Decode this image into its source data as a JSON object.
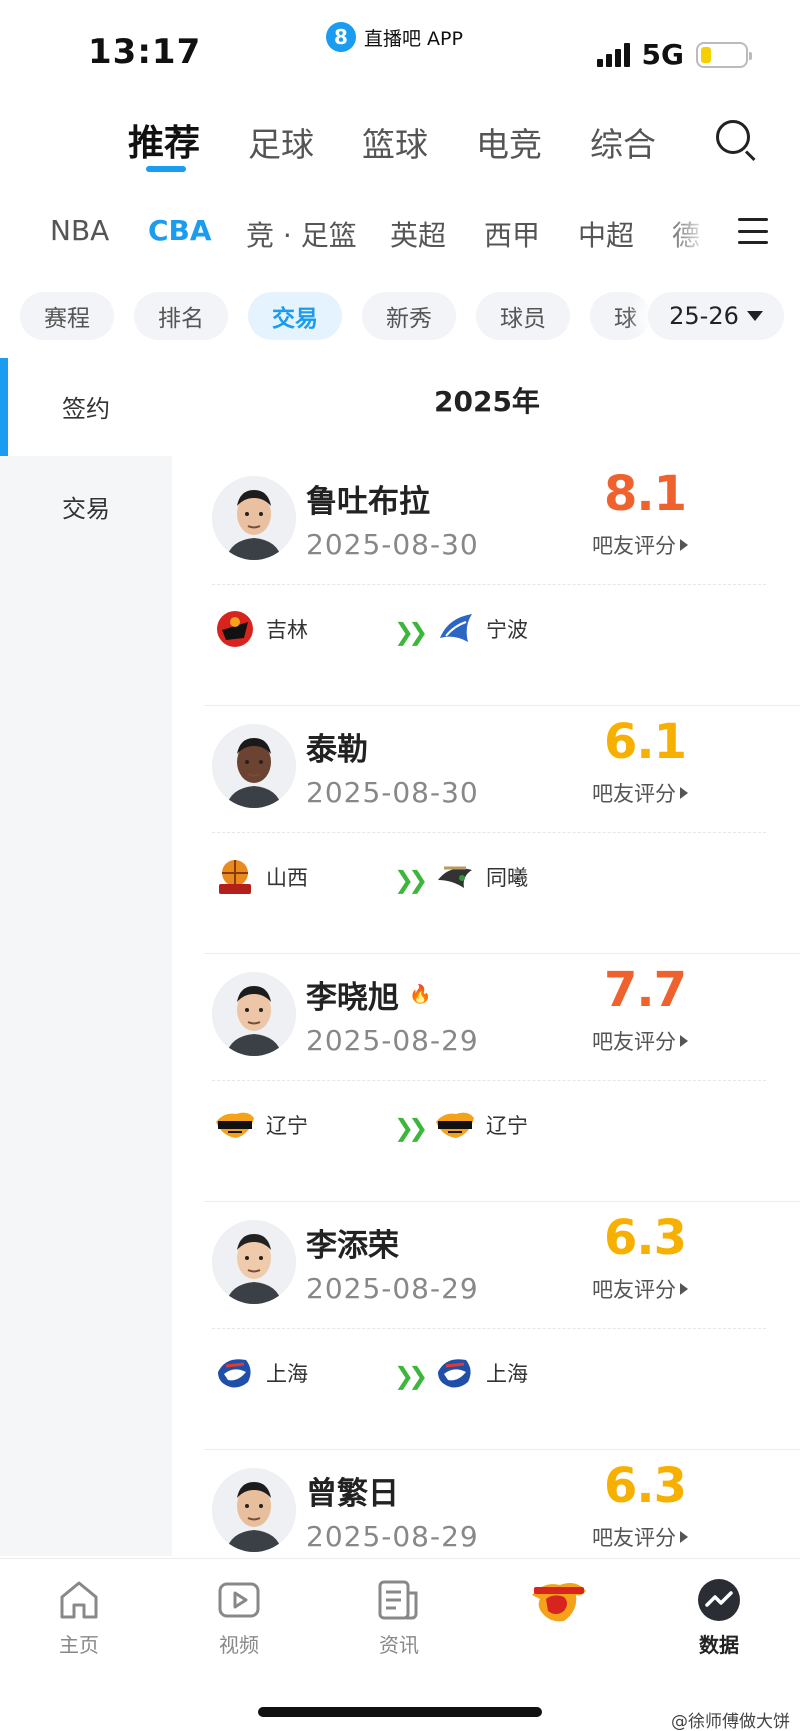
{
  "status_bar": {
    "time": "13:17",
    "app_name": "直播吧 APP",
    "app_logo_char": "8",
    "network": "5G"
  },
  "main_tabs": [
    {
      "label": "推荐",
      "active": true
    },
    {
      "label": "足球"
    },
    {
      "label": "篮球"
    },
    {
      "label": "电竞"
    },
    {
      "label": "综合"
    }
  ],
  "leagues": [
    {
      "label": "NBA"
    },
    {
      "label": "CBA",
      "active": true
    },
    {
      "label": "竞 · 足篮"
    },
    {
      "label": "英超"
    },
    {
      "label": "西甲"
    },
    {
      "label": "中超"
    },
    {
      "label": "德"
    }
  ],
  "filters": [
    {
      "label": "赛程"
    },
    {
      "label": "排名"
    },
    {
      "label": "交易",
      "active": true
    },
    {
      "label": "新秀"
    },
    {
      "label": "球员"
    },
    {
      "label": "球"
    }
  ],
  "season": "25-26",
  "side_nav": [
    {
      "label": "签约",
      "active": true
    },
    {
      "label": "交易"
    }
  ],
  "year_header": "2025年",
  "rating_label": "吧友评分",
  "colors": {
    "accent": "#1a9cf0",
    "score_high": "#f0622d",
    "score_mid": "#f7b000",
    "arrow_green": "#3cb73c"
  },
  "transfers": [
    {
      "name": "鲁吐布拉",
      "date": "2025-08-30",
      "score": "8.1",
      "score_color": "#f0622d",
      "hot": false,
      "from": "吉林",
      "to": "宁波",
      "from_logo": "jilin",
      "to_logo": "ningbo"
    },
    {
      "name": "泰勒",
      "date": "2025-08-30",
      "score": "6.1",
      "score_color": "#f7b000",
      "hot": false,
      "from": "山西",
      "to": "同曦",
      "from_logo": "shanxi",
      "to_logo": "tongxi"
    },
    {
      "name": "李晓旭",
      "date": "2025-08-29",
      "score": "7.7",
      "score_color": "#f0622d",
      "hot": true,
      "from": "辽宁",
      "to": "辽宁",
      "from_logo": "liaoning",
      "to_logo": "liaoning"
    },
    {
      "name": "李添荣",
      "date": "2025-08-29",
      "score": "6.3",
      "score_color": "#f7b000",
      "hot": false,
      "from": "上海",
      "to": "上海",
      "from_logo": "shanghai",
      "to_logo": "shanghai"
    },
    {
      "name": "曾繁日",
      "date": "2025-08-29",
      "score": "6.3",
      "score_color": "#f7b000",
      "hot": false,
      "from": "",
      "to": "",
      "from_logo": "",
      "to_logo": ""
    }
  ],
  "bottom_nav": [
    {
      "label": "主页",
      "icon": "home-icon"
    },
    {
      "label": "视频",
      "icon": "video-icon"
    },
    {
      "label": "资讯",
      "icon": "news-icon"
    },
    {
      "label": "",
      "icon": "team-logo-icon"
    },
    {
      "label": "数据",
      "icon": "data-icon",
      "active": true
    }
  ],
  "watermark": "@徐师傅做大饼"
}
